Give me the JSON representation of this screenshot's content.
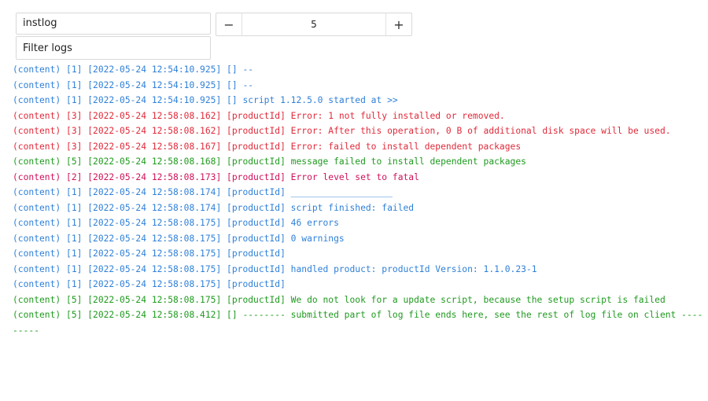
{
  "controls": {
    "log_type_value": "instlog",
    "level_value": "5",
    "decrement_label": "−",
    "increment_label": "+",
    "filter_placeholder": "Filter logs"
  },
  "colors": {
    "level_1": "#2f80d8",
    "level_2": "#d0115a",
    "level_3": "#e02a3a",
    "level_5": "#1f9a1f"
  },
  "log_lines": [
    {
      "level": 1,
      "text": "(content) [1] [2022-05-24 12:54:10.925] [] --"
    },
    {
      "level": 1,
      "text": "(content) [1] [2022-05-24 12:54:10.925] [] --"
    },
    {
      "level": 1,
      "text": "(content) [1] [2022-05-24 12:54:10.925] [] script 1.12.5.0 started at >>"
    },
    {
      "level": 3,
      "text": "(content) [3] [2022-05-24 12:58:08.162] [productId] Error: 1 not fully installed or removed."
    },
    {
      "level": 3,
      "text": "(content) [3] [2022-05-24 12:58:08.162] [productId] Error: After this operation, 0 B of additional disk space will be used."
    },
    {
      "level": 3,
      "text": "(content) [3] [2022-05-24 12:58:08.167] [productId] Error: failed to install dependent packages"
    },
    {
      "level": 5,
      "text": "(content) [5] [2022-05-24 12:58:08.168] [productId] message failed to install dependent packages"
    },
    {
      "level": 2,
      "text": "(content) [2] [2022-05-24 12:58:08.173] [productId] Error level set to fatal"
    },
    {
      "level": 1,
      "text": "(content) [1] [2022-05-24 12:58:08.174] [productId] ___________________"
    },
    {
      "level": 1,
      "text": "(content) [1] [2022-05-24 12:58:08.174] [productId] script finished: failed"
    },
    {
      "level": 1,
      "text": "(content) [1] [2022-05-24 12:58:08.175] [productId] 46 errors"
    },
    {
      "level": 1,
      "text": "(content) [1] [2022-05-24 12:58:08.175] [productId] 0 warnings"
    },
    {
      "level": 1,
      "text": "(content) [1] [2022-05-24 12:58:08.175] [productId]"
    },
    {
      "level": 1,
      "text": "(content) [1] [2022-05-24 12:58:08.175] [productId] handled product: productId Version: 1.1.0.23-1"
    },
    {
      "level": 1,
      "text": "(content) [1] [2022-05-24 12:58:08.175] [productId]"
    },
    {
      "level": 5,
      "text": "(content) [5] [2022-05-24 12:58:08.175] [productId] We do not look for a update script, because the setup script is failed"
    },
    {
      "level": 5,
      "text": "(content) [5] [2022-05-24 12:58:08.412] [] -------- submitted part of log file ends here, see the rest of log file on client ---------"
    }
  ]
}
